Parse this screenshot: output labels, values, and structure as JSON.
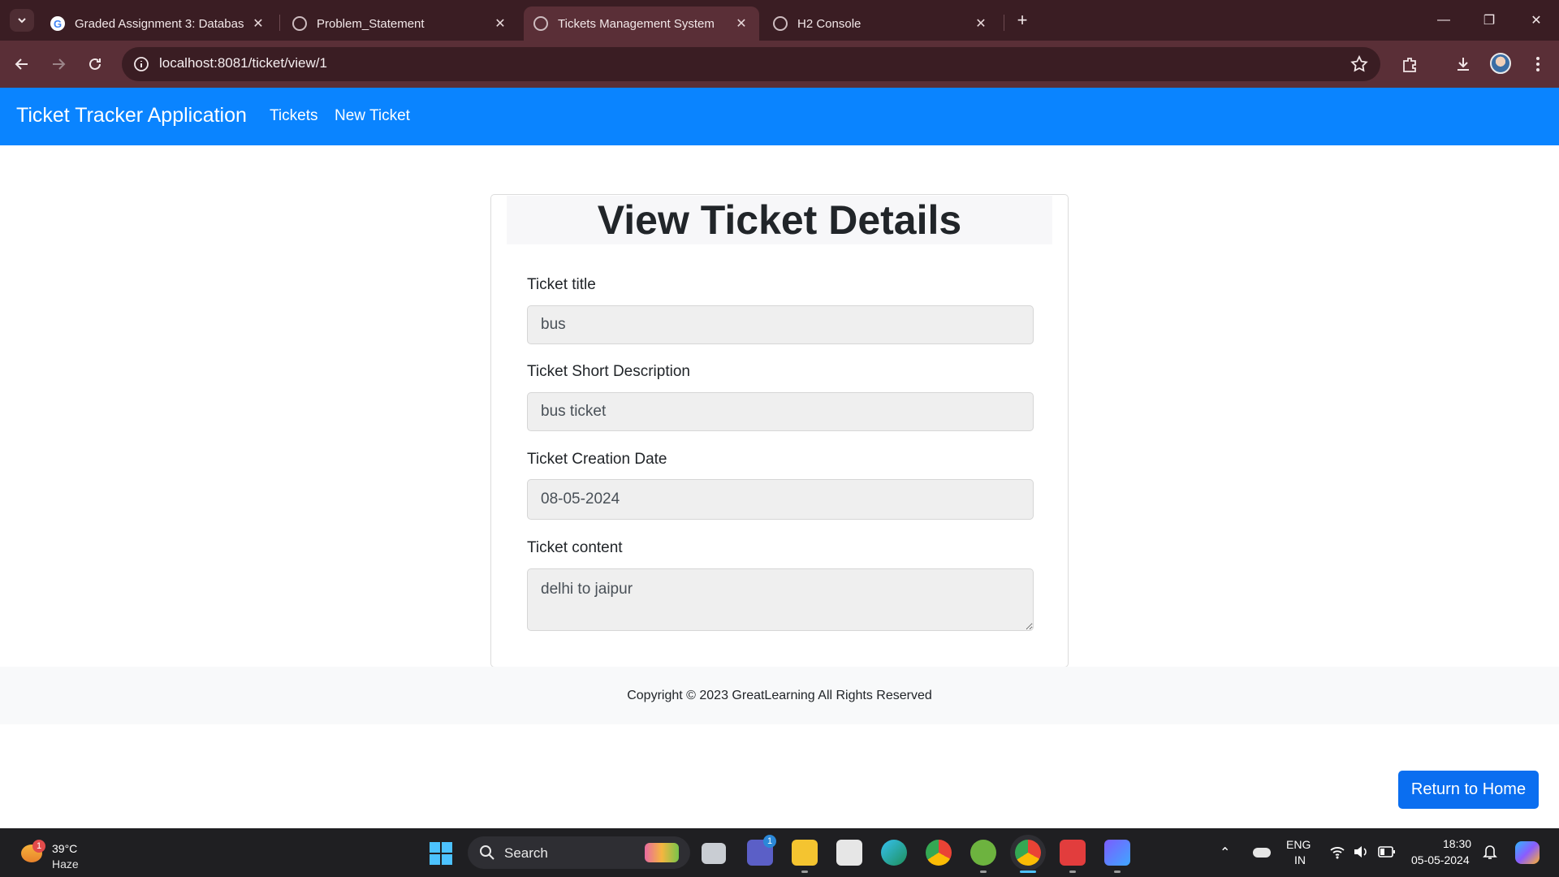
{
  "browser": {
    "tabs": [
      {
        "title": "Graded Assignment 3: Databas",
        "active": false
      },
      {
        "title": "Problem_Statement",
        "active": false
      },
      {
        "title": "Tickets Management System",
        "active": true
      },
      {
        "title": "H2 Console",
        "active": false
      }
    ],
    "url": "localhost:8081/ticket/view/1"
  },
  "app": {
    "brand": "Ticket Tracker Application",
    "nav": [
      "Tickets",
      "New Ticket"
    ]
  },
  "form": {
    "heading": "View Ticket Details",
    "title_label": "Ticket title",
    "title_value": "bus",
    "short_desc_label": "Ticket Short Description",
    "short_desc_value": "bus ticket",
    "date_label": "Ticket Creation Date",
    "date_value": "08-05-2024",
    "content_label": "Ticket content",
    "content_value": "delhi to jaipur"
  },
  "footer": {
    "copyright": "Copyright © 2023 GreatLearning All Rights Reserved"
  },
  "return_button": "Return to Home",
  "taskbar": {
    "weather_temp": "39°C",
    "weather_cond": "Haze",
    "weather_badge": "1",
    "search": "Search",
    "teams_badge": "1",
    "lang_top": "ENG",
    "lang_bottom": "IN",
    "time": "18:30",
    "date": "05-05-2024"
  },
  "colors": {
    "navbar": "#0a84ff",
    "button": "#0a6ef0",
    "browser_frame": "#3a1d23",
    "browser_toolbar": "#5a2f37"
  }
}
